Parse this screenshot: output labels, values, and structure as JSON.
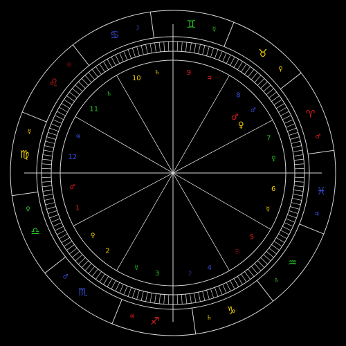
{
  "chart": {
    "colors": {
      "background": "#000000",
      "lines": "#d8d8d8",
      "fire": "#e21e1e",
      "earth": "#f0d000",
      "air": "#25c425",
      "water": "#3b4fe0"
    },
    "signs": [
      {
        "name": "aries",
        "glyph": "♈",
        "element": "fire",
        "ruler": "♂"
      },
      {
        "name": "taurus",
        "glyph": "♉",
        "element": "earth",
        "ruler": "♀"
      },
      {
        "name": "gemini",
        "glyph": "♊",
        "element": "air",
        "ruler": "☿"
      },
      {
        "name": "cancer",
        "glyph": "♋",
        "element": "water",
        "ruler": "☽"
      },
      {
        "name": "leo",
        "glyph": "♌",
        "element": "fire",
        "ruler": "☉"
      },
      {
        "name": "virgo",
        "glyph": "♍",
        "element": "earth",
        "ruler": "☿"
      },
      {
        "name": "libra",
        "glyph": "♎",
        "element": "air",
        "ruler": "♀"
      },
      {
        "name": "scorpio",
        "glyph": "♏",
        "element": "water",
        "ruler": "♂"
      },
      {
        "name": "sagittarius",
        "glyph": "♐",
        "element": "fire",
        "ruler": "♃"
      },
      {
        "name": "capricorn",
        "glyph": "♑",
        "element": "earth",
        "ruler": "♄"
      },
      {
        "name": "aquarius",
        "glyph": "♒",
        "element": "air",
        "ruler": "♄"
      },
      {
        "name": "pisces",
        "glyph": "♓",
        "element": "water",
        "ruler": "♃"
      }
    ],
    "houses": [
      {
        "label": "1",
        "element": "fire",
        "ruler": "♂"
      },
      {
        "label": "2",
        "element": "earth",
        "ruler": "♀"
      },
      {
        "label": "3",
        "element": "air",
        "ruler": "☿"
      },
      {
        "label": "4",
        "element": "water",
        "ruler": "☽"
      },
      {
        "label": "5",
        "element": "fire",
        "ruler": "☉"
      },
      {
        "label": "6",
        "element": "earth",
        "ruler": "☿"
      },
      {
        "label": "7",
        "element": "air",
        "ruler": "♀"
      },
      {
        "label": "8",
        "element": "water",
        "ruler": "♂"
      },
      {
        "label": "9",
        "element": "fire",
        "ruler": "♃"
      },
      {
        "label": "10",
        "element": "earth",
        "ruler": "♄"
      },
      {
        "label": "11",
        "element": "air",
        "ruler": "♄"
      },
      {
        "label": "12",
        "element": "water",
        "ruler": "♃"
      }
    ],
    "planets": [
      {
        "name": "venus",
        "glyph": "♀",
        "element": "earth",
        "house": 1
      },
      {
        "name": "mars",
        "glyph": "♂",
        "element": "fire",
        "house": 1
      }
    ]
  }
}
